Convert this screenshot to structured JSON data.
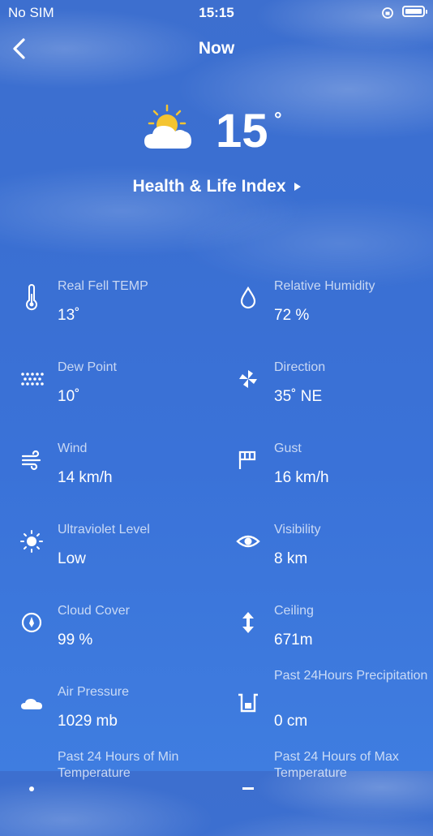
{
  "status_bar": {
    "carrier": "No SIM",
    "time": "15:15"
  },
  "nav": {
    "title": "Now",
    "back_icon": "chevron-left-icon"
  },
  "hero": {
    "temperature": "15",
    "degree": "°",
    "icon": "partly-cloudy-sun-icon"
  },
  "health_link": {
    "label": "Health & Life Index"
  },
  "metrics": [
    {
      "label": "Real Fell TEMP",
      "value": "13˚",
      "icon": "thermometer-icon"
    },
    {
      "label": "Relative Humidity",
      "value": "72 %",
      "icon": "droplet-icon"
    },
    {
      "label": "Dew Point",
      "value": "10˚",
      "icon": "dew-dots-icon"
    },
    {
      "label": "Direction",
      "value": "35˚ NE",
      "icon": "pinwheel-icon"
    },
    {
      "label": "Wind",
      "value": "14 km/h",
      "icon": "wind-icon"
    },
    {
      "label": "Gust",
      "value": "16 km/h",
      "icon": "flag-icon"
    },
    {
      "label": "Ultraviolet Level",
      "value": "Low",
      "icon": "sun-icon"
    },
    {
      "label": "Visibility",
      "value": "8 km",
      "icon": "eye-icon"
    },
    {
      "label": "Cloud Cover",
      "value": "99 %",
      "icon": "compass-icon"
    },
    {
      "label": "Ceiling",
      "value": "671m",
      "icon": "vertical-arrows-icon"
    },
    {
      "label": "Air Pressure",
      "value": "1029 mb",
      "icon": "cloud-icon"
    },
    {
      "label": "Past 24Hours Precipitation",
      "value": "0 cm",
      "icon": "rain-gauge-icon"
    },
    {
      "label": "Past 24 Hours of Min Temperature",
      "value": "",
      "icon": "min-temp-icon"
    },
    {
      "label": "Past 24 Hours of Max Temperature",
      "value": "",
      "icon": "max-temp-icon"
    }
  ]
}
